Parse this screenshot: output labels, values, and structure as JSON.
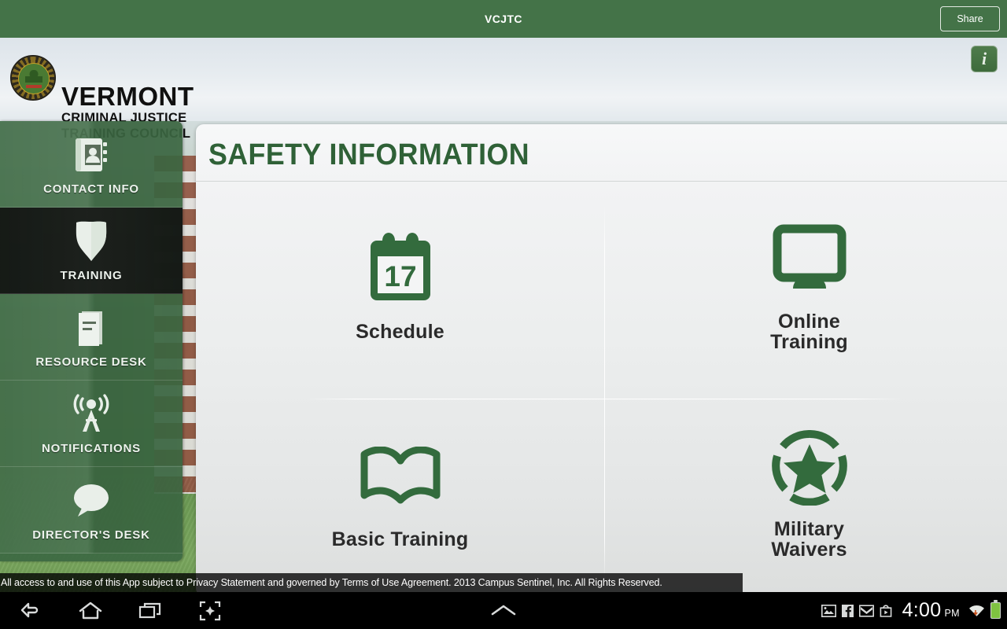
{
  "appbar": {
    "title": "VCJTC",
    "share_label": "Share"
  },
  "header": {
    "brand_line1": "VERMONT",
    "brand_line2": "CRIMINAL JUSTICE",
    "brand_line3": "TRAINING COUNCIL",
    "info_label": "i",
    "seal_name": "vermont-criminal-justice-training-council-seal"
  },
  "sidebar": {
    "items": [
      {
        "label": "CONTACT INFO",
        "icon": "address-book-icon",
        "active": false
      },
      {
        "label": "TRAINING",
        "icon": "shield-icon",
        "active": true
      },
      {
        "label": "RESOURCE DESK",
        "icon": "book-icon",
        "active": false
      },
      {
        "label": "NOTIFICATIONS",
        "icon": "broadcast-tower-icon",
        "active": false
      },
      {
        "label": "DIRECTOR'S DESK",
        "icon": "speech-bubble-icon",
        "active": false
      }
    ]
  },
  "main": {
    "title": "SAFETY INFORMATION",
    "tiles": [
      {
        "label": "Schedule",
        "icon": "calendar-icon",
        "calendar_day": "17"
      },
      {
        "label": "Online\nTraining",
        "icon": "monitor-icon"
      },
      {
        "label": "Basic Training",
        "icon": "open-book-icon"
      },
      {
        "label": "Military\nWaivers",
        "icon": "star-circle-icon"
      }
    ]
  },
  "footer": {
    "legal": "All access to and use of this App subject to Privacy Statement and governed by Terms of Use Agreement. 2013 Campus Sentinel, Inc. All Rights Reserved."
  },
  "system": {
    "clock_time": "4:00",
    "clock_ampm": "PM",
    "nav": [
      "back-icon",
      "home-icon",
      "recents-icon",
      "screenshot-icon"
    ],
    "status_icons": [
      "image-icon",
      "facebook-icon",
      "gmail-icon",
      "play-store-icon",
      "wifi-icon",
      "battery-icon"
    ]
  },
  "colors": {
    "appbar_green": "#447348",
    "brand_green": "#2f6137",
    "icon_green": "#336b3d",
    "sidebar_green": "#3c6842",
    "active_dark": "#141614"
  }
}
